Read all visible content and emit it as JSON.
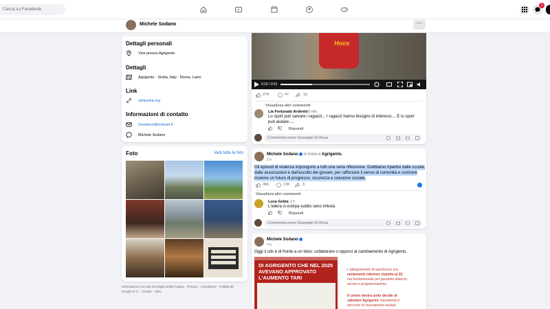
{
  "topbar": {
    "search_placeholder": "Cerca su Facebook",
    "notification_count": "1"
  },
  "profile_bar": {
    "name": "Michele Sodano",
    "more_label": "···"
  },
  "personal": {
    "title": "Dettagli personali",
    "lives": "Vive presso Agrigento"
  },
  "details": {
    "title": "Dettagli",
    "places": "Agrigento · Sicilia, Italy · Roma, Lazio"
  },
  "link": {
    "title": "Link",
    "url": "wikipedia.org"
  },
  "contact": {
    "title": "Informazioni di contatto",
    "email": "msodano@hotmail.it",
    "messenger": "Michele Sodano"
  },
  "photos": {
    "title": "Foto",
    "see_all": "Vedi tutte le foto"
  },
  "footer": {
    "line1": "Informazioni sui dati di Insight della Pagina · Privacy · Condizioni · Pubblicità",
    "line2": "Scegli tu! ▷ · Cookie · Altro"
  },
  "video": {
    "time": "0:16 / 0:51",
    "shirt_text": "Hoos"
  },
  "post1": {
    "likes": "274",
    "comments": "47",
    "shares": "16",
    "view_more": "Visualizza altri commenti",
    "comment": {
      "author": "Lia Fortunato Ardento",
      "time": "53 min",
      "text1": "Lo sport può salvare i ragazzi... I ragazzi hanno bisogno di interessi.... E lo sport",
      "text2": "può aiutare.....",
      "reply": "Rispondi"
    },
    "input": "Commenta come Giuseppe Di Rosa"
  },
  "post2": {
    "author": "Michele Sodano",
    "location_prefix": "si trova a",
    "location": "Agrigento.",
    "time": "2 h",
    "line1": "Gli episodi di violenza impongono a tutti una seria riflessione. Dobbiamo ripartire dalle scuole,",
    "line2": "dalle associazioni e dall'ascolto dei giovani, per rafforzare il senso di comunità e costruire",
    "line3": "insieme un futuro di progresso, sicurezza e coesione sociale.",
    "likes": "386",
    "comments": "130",
    "shares": "3",
    "view_more": "Visualizza altri commenti",
    "comment": {
      "author": "Luca Gebia",
      "time": "2 h",
      "text": "L'edera si estirpa subito seno infesta",
      "reply": "Rispondi"
    },
    "input": "Commenta come Giuseppe Di Rosa"
  },
  "post3": {
    "author": "Michele Sodano",
    "time": "7 h",
    "text": "Oggi il cds è di fronte a un bivio: collaborare o opporsi al cambiamento di Agrigento.",
    "poster_head1": "DI AGRIGENTO CHE NEL 2025",
    "poster_head2": "AVEVANO APPROVATO",
    "poster_head3": "L'AUMENTO TARI",
    "right_p1a": "L'adeguamento di quest'anno era",
    "right_p1b": "nettamente inferiore rispetto al 25,",
    "right_p1c": "ma fondamentale per garantire bilancio,",
    "right_p1d": "servizi e programmazione",
    "right_p2a": "Il centro destra unito decide di",
    "right_p2b": "sabotare Agrigento",
    "right_p2c": "impedendo il",
    "right_p2d": "percorso di risanamento avviato"
  },
  "colors": {
    "accent": "#216fdb",
    "like": "#1877f2",
    "selection": "#c2dbfe"
  }
}
